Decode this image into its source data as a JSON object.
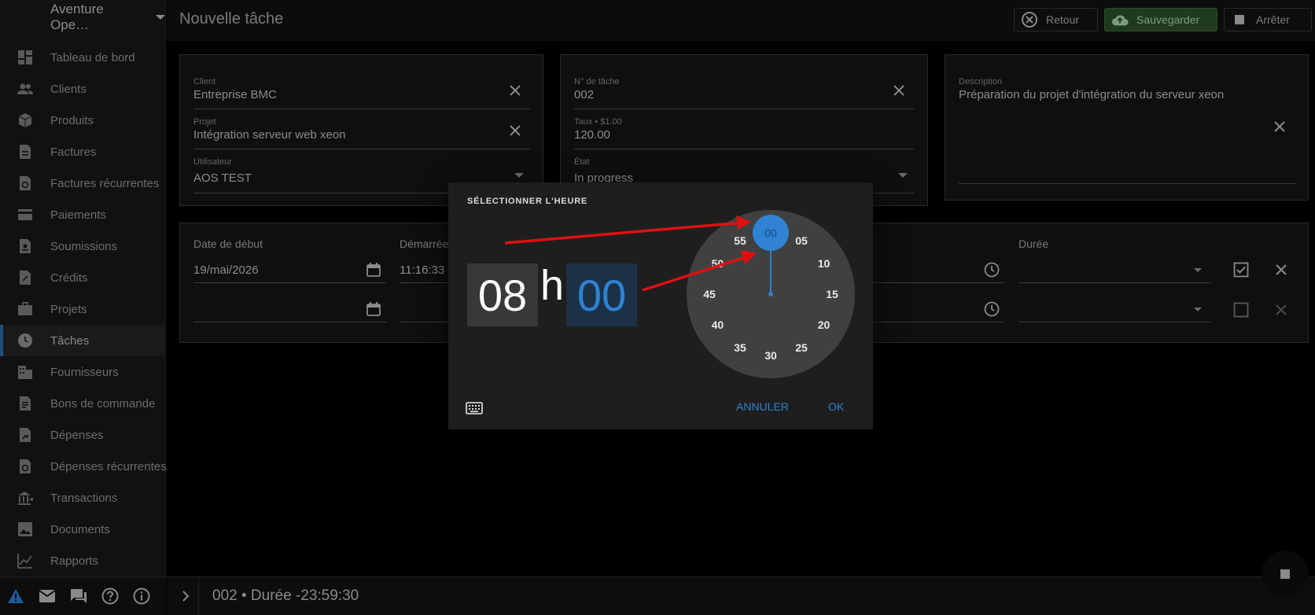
{
  "app": {
    "company": "Aventure Ope…",
    "page_title": "Nouvelle tâche"
  },
  "toolbar": {
    "back_label": "Retour",
    "save_label": "Sauvegarder",
    "stop_label": "Arrêter"
  },
  "sidebar": {
    "items": [
      {
        "label": "Tableau de bord",
        "icon": "dashboard-icon"
      },
      {
        "label": "Clients",
        "icon": "people-icon"
      },
      {
        "label": "Produits",
        "icon": "cube-icon"
      },
      {
        "label": "Factures",
        "icon": "invoice-icon"
      },
      {
        "label": "Factures récurrentes",
        "icon": "recurring-invoice-icon"
      },
      {
        "label": "Paiements",
        "icon": "credit-card-icon"
      },
      {
        "label": "Soumissions",
        "icon": "quote-icon"
      },
      {
        "label": "Crédits",
        "icon": "credit-icon"
      },
      {
        "label": "Projets",
        "icon": "briefcase-icon"
      },
      {
        "label": "Tâches",
        "icon": "clock-icon"
      },
      {
        "label": "Fournisseurs",
        "icon": "building-icon"
      },
      {
        "label": "Bons de commande",
        "icon": "purchase-order-icon"
      },
      {
        "label": "Dépenses",
        "icon": "expense-icon"
      },
      {
        "label": "Dépenses récurrentes",
        "icon": "recurring-expense-icon"
      },
      {
        "label": "Transactions",
        "icon": "bank-icon"
      },
      {
        "label": "Documents",
        "icon": "image-icon"
      },
      {
        "label": "Rapports",
        "icon": "chart-icon"
      }
    ],
    "active": "Tâches"
  },
  "form": {
    "client": {
      "label": "Client",
      "value": "Entreprise BMC"
    },
    "project": {
      "label": "Projet",
      "value": "Intégration serveur web xeon"
    },
    "user": {
      "label": "Utilisateur",
      "value": "AOS TEST"
    },
    "task_number": {
      "label": "N° de tâche",
      "value": "002"
    },
    "rate": {
      "label": "Taux • $1.00",
      "value": "120.00"
    },
    "state": {
      "label": "État",
      "value": "In progress"
    },
    "description": {
      "label": "Description",
      "value": "Préparation du projet d'intégration du serveur xeon"
    }
  },
  "time_table": {
    "headers": {
      "start_date": "Date de début",
      "started": "Démarrée",
      "duration": "Durée"
    },
    "rows": [
      {
        "date": "19/mai/2026",
        "time": "11:16:33"
      },
      {
        "date": "",
        "time": ""
      }
    ]
  },
  "footer": {
    "status": "002 • Durée -23:59:30"
  },
  "time_picker": {
    "title": "SÉLECTIONNER L'HEURE",
    "hour": "08",
    "separator": "h",
    "minute": "00",
    "selected": "00",
    "dial": [
      "00",
      "05",
      "10",
      "15",
      "20",
      "25",
      "30",
      "35",
      "40",
      "45",
      "50",
      "55"
    ],
    "cancel_label": "ANNULER",
    "ok_label": "OK"
  },
  "colors": {
    "accent": "#2f83d2",
    "save_bg": "#1f3a1d",
    "annotation_arrow": "#e01010"
  }
}
